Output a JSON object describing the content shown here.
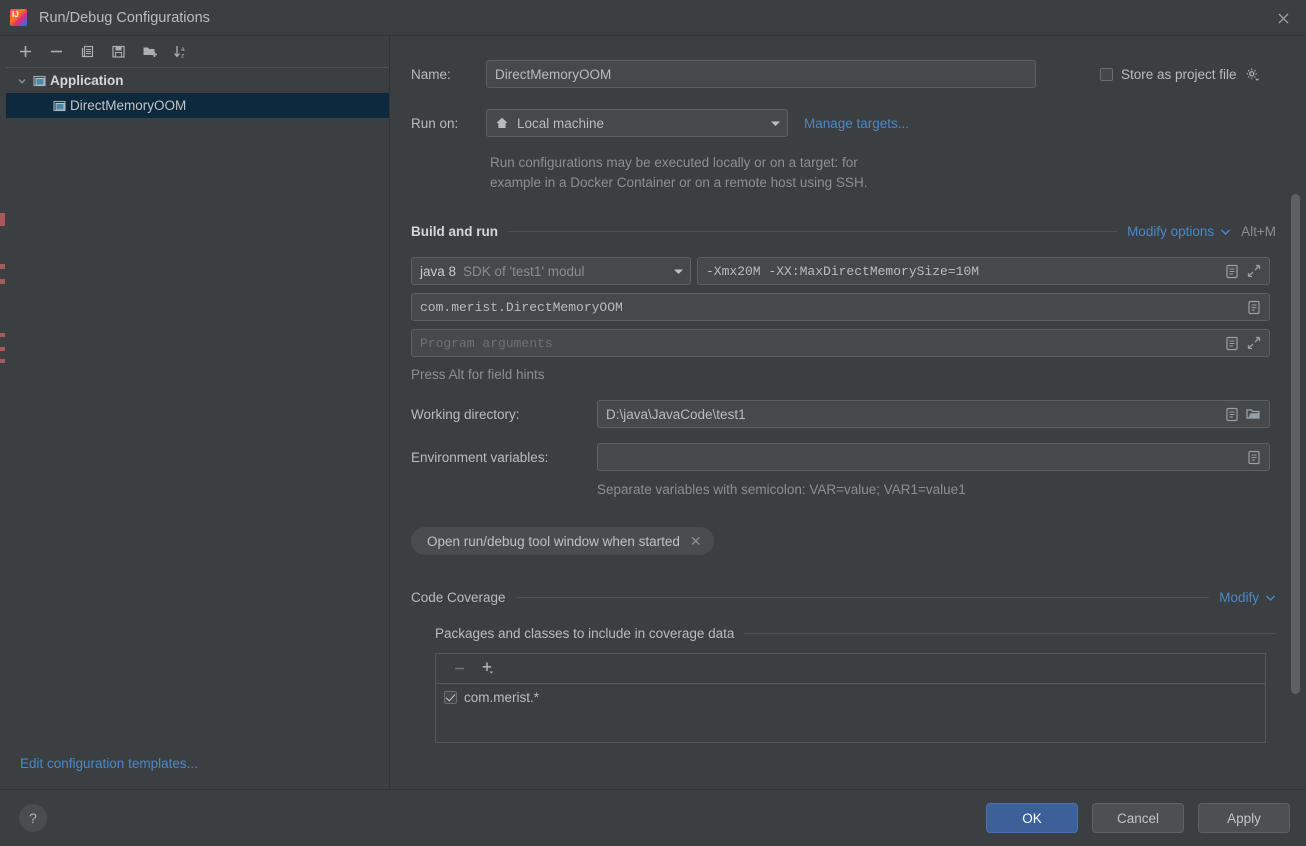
{
  "window": {
    "title": "Run/Debug Configurations",
    "logo_icon": "intellij-idea-logo",
    "close_icon": "close-icon"
  },
  "sidebar": {
    "toolbar": [
      {
        "name": "add-configuration-button",
        "icon": "plus-icon"
      },
      {
        "name": "remove-configuration-button",
        "icon": "minus-icon"
      },
      {
        "name": "copy-configuration-button",
        "icon": "copy-icon"
      },
      {
        "name": "save-configuration-button",
        "icon": "save-icon"
      },
      {
        "name": "new-folder-button",
        "icon": "folder-add-icon"
      },
      {
        "name": "sort-configurations-button",
        "icon": "sort-alphabetically-icon"
      }
    ],
    "tree": [
      {
        "label": "Application",
        "type": "group",
        "expanded": true,
        "icon": "application-icon"
      },
      {
        "label": "DirectMemoryOOM",
        "type": "child",
        "selected": true,
        "icon": "application-icon"
      }
    ],
    "edit_templates_link": "Edit configuration templates..."
  },
  "form": {
    "name_label": "Name:",
    "name_value": "DirectMemoryOOM",
    "store_as_project_file_label": "Store as project file",
    "store_as_project_file_checked": false,
    "store_gear_icon": "gear-icon",
    "run_on_label": "Run on:",
    "run_on_value": "Local machine",
    "run_on_icon": "home-icon",
    "manage_targets_link": "Manage targets...",
    "run_on_hint_line1": "Run configurations may be executed locally or on a target: for",
    "run_on_hint_line2": "example in a Docker Container or on a remote host using SSH.",
    "build_and_run_title": "Build and run",
    "modify_options_link": "Modify options",
    "modify_options_shortcut": "Alt+M",
    "sdk_primary": "java 8",
    "sdk_secondary": "SDK of 'test1' modul",
    "vm_options_value": "-Xmx20M -XX:MaxDirectMemorySize=10M",
    "main_class_value": "com.merist.DirectMemoryOOM",
    "program_arguments_placeholder": "Program arguments",
    "field_hints_text": "Press Alt for field hints",
    "working_directory_label": "Working directory:",
    "working_directory_value": "D:\\java\\JavaCode\\test1",
    "environment_variables_label": "Environment variables:",
    "environment_variables_value": "",
    "environment_variables_hint": "Separate variables with semicolon: VAR=value; VAR1=value1",
    "open_tool_window_chip": "Open run/debug tool window when started",
    "chip_close_icon": "close-icon",
    "macro_icon": "insert-macro-icon",
    "expand_icon": "expand-field-icon",
    "browse_icon": "browse-folder-icon"
  },
  "code_coverage": {
    "title": "Code Coverage",
    "modify_link": "Modify",
    "packages_title": "Packages and classes to include in coverage data",
    "toolbar": [
      {
        "name": "remove-package-button",
        "icon": "minus-icon",
        "disabled": true
      },
      {
        "name": "add-package-button",
        "icon": "plus-dropdown-icon",
        "disabled": false
      }
    ],
    "items": [
      {
        "label": "com.merist.*",
        "checked": true
      }
    ]
  },
  "footer": {
    "help_icon": "help-icon",
    "ok_label": "OK",
    "cancel_label": "Cancel",
    "apply_label": "Apply"
  },
  "colors": {
    "background": "#3c3f41",
    "field_background": "#45494a",
    "selection": "#0d293e",
    "link": "#4a88c7",
    "primary_button": "#3c6199"
  }
}
